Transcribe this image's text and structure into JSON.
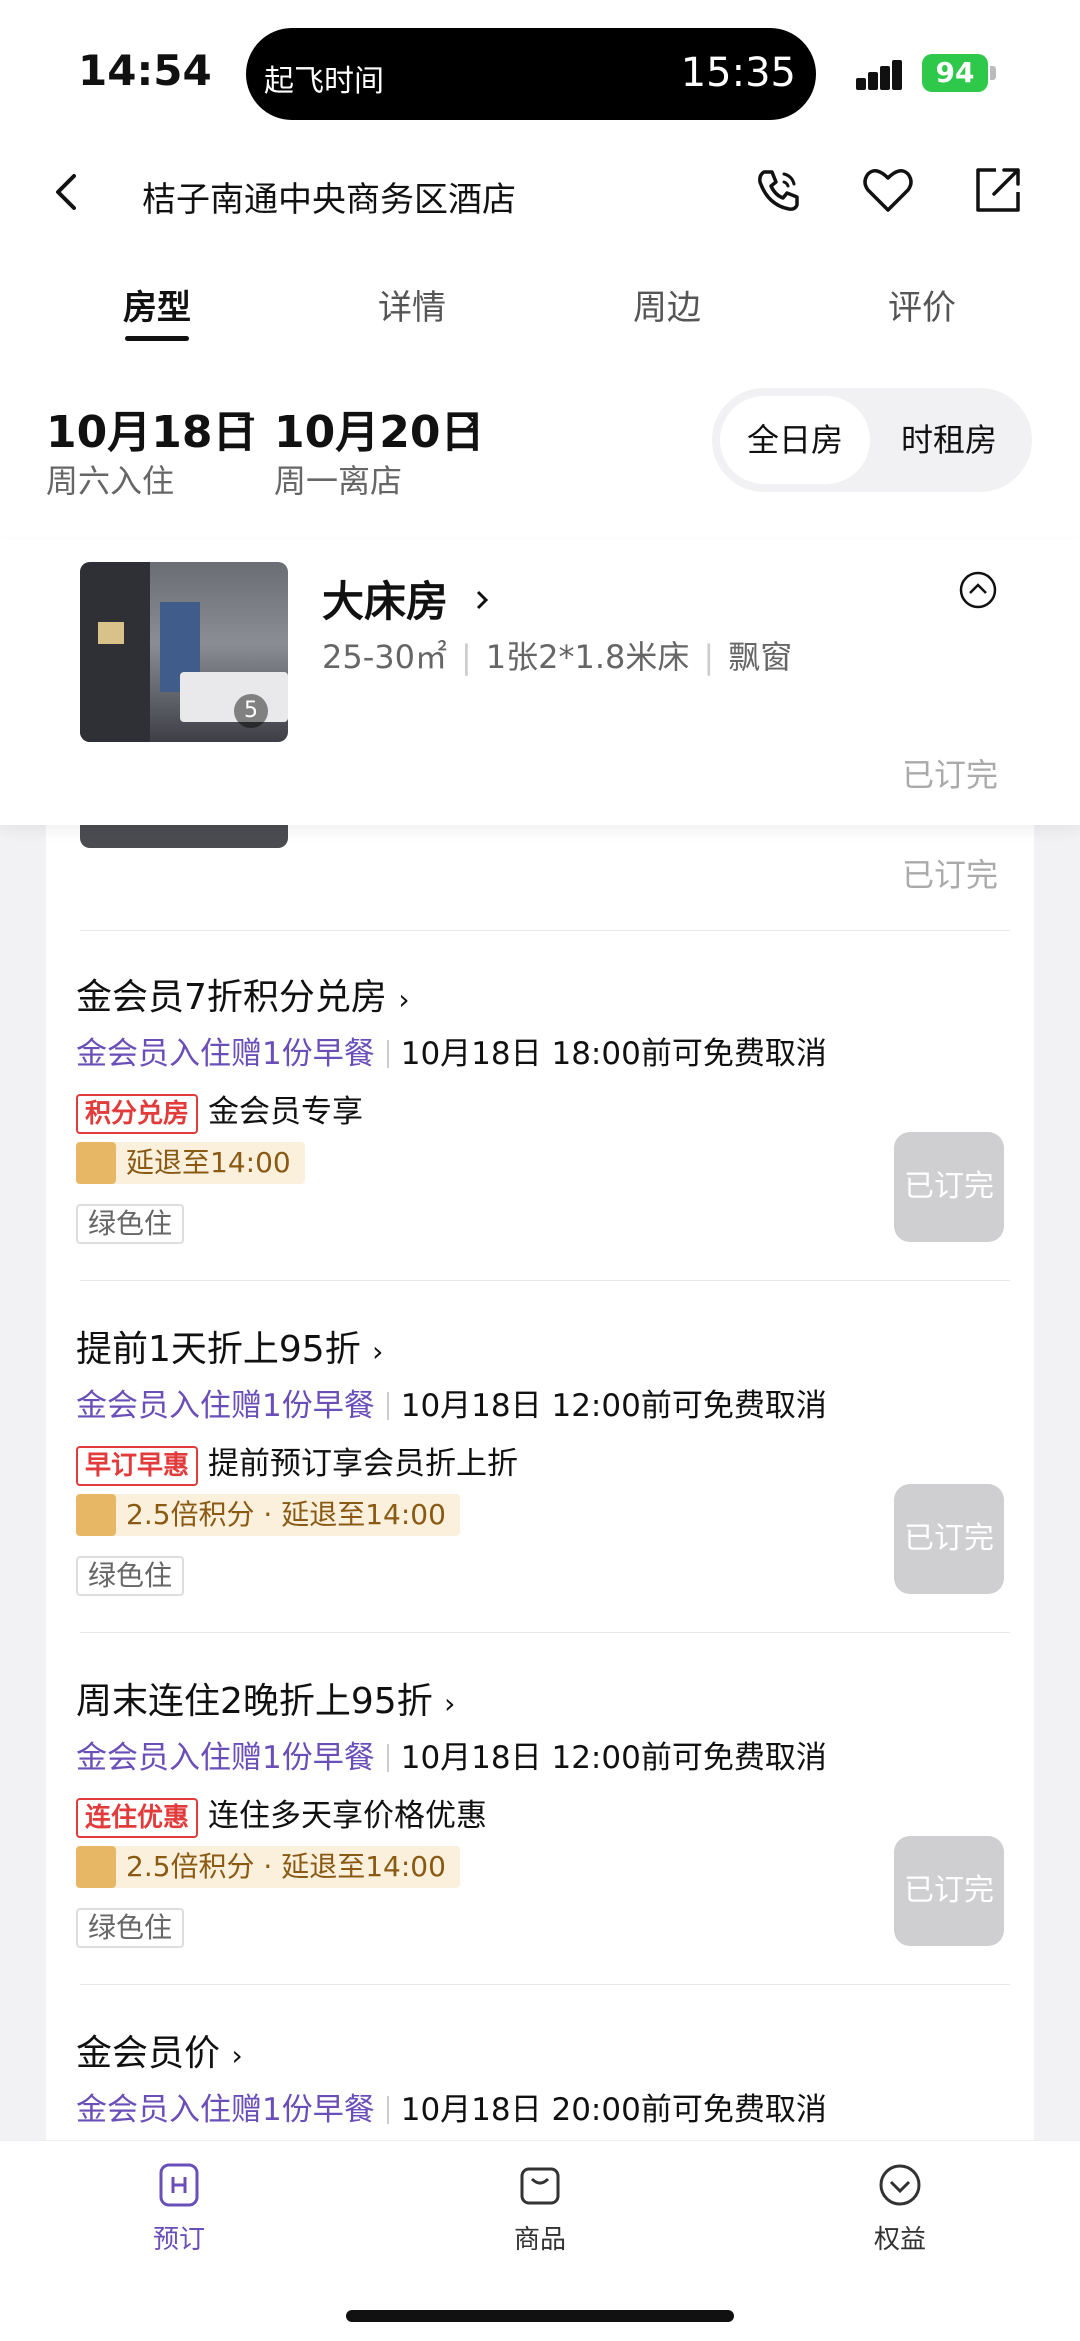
{
  "status": {
    "time": "14:54",
    "island_label": "起飞时间",
    "island_time": "15:35",
    "battery": "94"
  },
  "header": {
    "hotel_name": "桔子南通中央商务区酒店"
  },
  "tabs": [
    {
      "label": "房型"
    },
    {
      "label": "详情"
    },
    {
      "label": "周边"
    },
    {
      "label": "评价"
    }
  ],
  "dates": {
    "checkin_date": "10月18日",
    "checkout_date": "10月20日",
    "checkin_sub": "周六入住",
    "checkout_sub": "周一离店",
    "seg_full_day": "全日房",
    "seg_hourly": "时租房"
  },
  "room": {
    "name": "大床房",
    "area": "25-30㎡",
    "bed": "1张2*1.8米床",
    "window": "飘窗",
    "photo_count": "5",
    "soldout_text": "已订完"
  },
  "offers": [
    {
      "title": "金会员7折积分兑房",
      "benefit": "金会员入住赠1份早餐",
      "cancel": "10月18日 18:00前可免费取消",
      "tag": "积分兑房",
      "tag_desc": "金会员专享",
      "gold": "延退至14:00",
      "green": "绿色住",
      "button": "已订完"
    },
    {
      "title": "提前1天折上95折",
      "benefit": "金会员入住赠1份早餐",
      "cancel": "10月18日 12:00前可免费取消",
      "tag": "早订早惠",
      "tag_desc": "提前预订享会员折上折",
      "gold": "2.5倍积分 · 延退至14:00",
      "green": "绿色住",
      "button": "已订完"
    },
    {
      "title": "周末连住2晚折上95折",
      "benefit": "金会员入住赠1份早餐",
      "cancel": "10月18日 12:00前可免费取消",
      "tag": "连住优惠",
      "tag_desc": "连住多天享价格优惠",
      "gold": "2.5倍积分 · 延退至14:00",
      "green": "绿色住",
      "button": "已订完"
    },
    {
      "title": "金会员价",
      "benefit": "金会员入住赠1份早餐",
      "cancel": "10月18日 20:00前可免费取消"
    }
  ],
  "bottom_nav": [
    {
      "label": "预订"
    },
    {
      "label": "商品"
    },
    {
      "label": "权益"
    }
  ],
  "colors": {
    "accent_purple": "#6b4fb8",
    "tag_red": "#e23b3b",
    "battery_green": "#2ec94a"
  }
}
